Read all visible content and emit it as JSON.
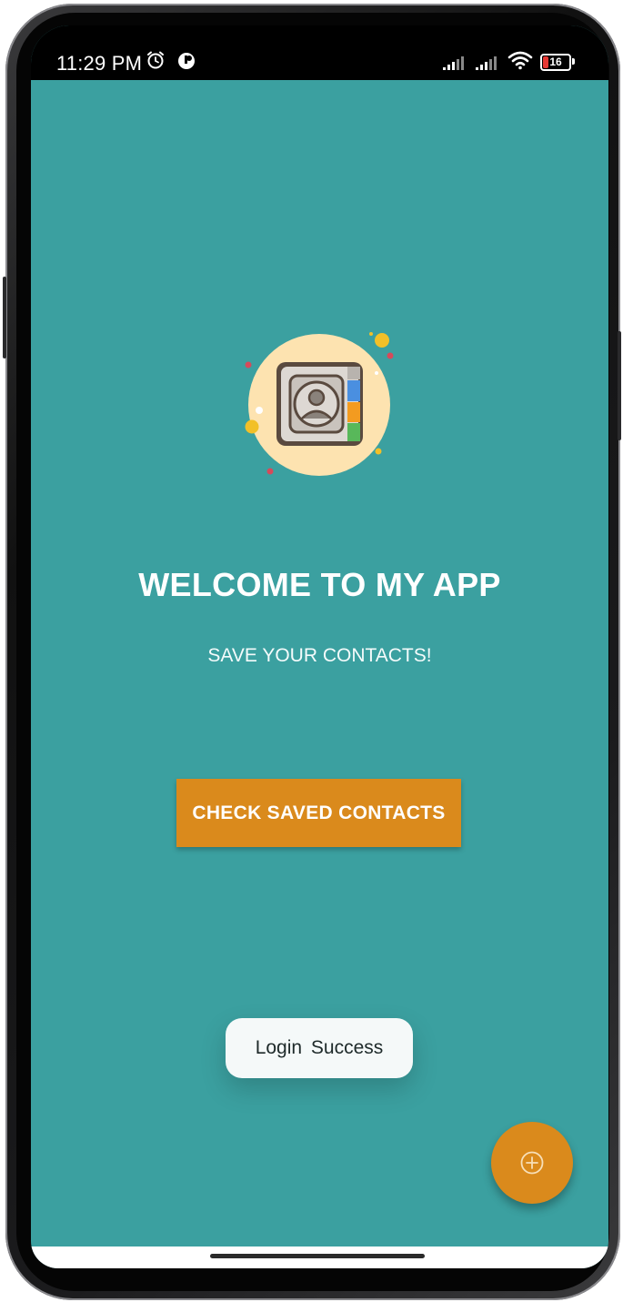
{
  "statusbar": {
    "time": "11:29 PM",
    "battery_level": "16",
    "icons": [
      "alarm-icon",
      "app-notification-icon",
      "signal-icon",
      "signal-icon",
      "wifi-icon",
      "battery-icon"
    ]
  },
  "app": {
    "logo_icon": "contact-book-icon",
    "title": "WELCOME TO MY APP",
    "subtitle": "SAVE YOUR CONTACTS!",
    "primary_button_label": "CHECK SAVED CONTACTS",
    "fab_icon": "add-icon"
  },
  "toast": {
    "message": "Login  Success"
  },
  "colors": {
    "background": "#3ba0a0",
    "accent": "#da8a1c",
    "toast_bg": "#f5f9f9"
  }
}
